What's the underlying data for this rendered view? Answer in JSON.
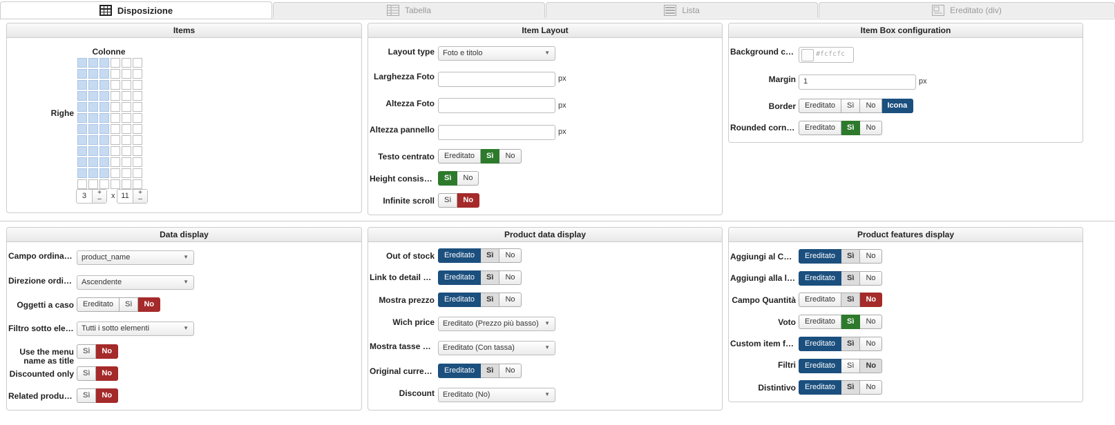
{
  "tabs": [
    "Disposizione",
    "Tabella",
    "Lista",
    "Ereditato (div)"
  ],
  "items_panel": {
    "title": "Items",
    "colonne_label": "Colonne",
    "righe_label": "Righe",
    "columns_value": "3",
    "rows_value": "11",
    "x_label": "x",
    "plus": "+",
    "minus": "–",
    "selected_columns": 3,
    "selected_rows": 11,
    "grid_columns": 6,
    "grid_rows": 12
  },
  "item_layout": {
    "title": "Item Layout",
    "layout_type_label": "Layout type",
    "layout_type_value": "Foto e titolo",
    "larghezza_label": "Larghezza Foto",
    "altezza_foto_label": "Altezza Foto",
    "altezza_pannello_label": "Altezza pannello",
    "unit_px": "px",
    "testo_centrato_label": "Testo centrato",
    "height_consistency_label": "Height consistency",
    "infinite_scroll_label": "Infinite scroll",
    "opt_ereditato": "Ereditato",
    "opt_si": "Sì",
    "opt_no": "No"
  },
  "item_box": {
    "title": "Item Box configuration",
    "background_color_label": "Background color",
    "background_color_placeholder": "#fcfcfc",
    "margin_label": "Margin",
    "margin_value": "1",
    "border_label": "Border",
    "rounded_label": "Rounded corners",
    "opt_icona": "Icona"
  },
  "data_display": {
    "title": "Data display",
    "campo_label": "Campo ordiname…",
    "campo_value": "product_name",
    "direzione_label": "Direzione ordina…",
    "direzione_value": "Ascendente",
    "oggetti_label": "Oggetti a caso",
    "filtro_label": "Filtro sotto eleme…",
    "filtro_value": "Tutti i sotto elementi",
    "use_menu_label_1": "Use the menu",
    "use_menu_label_2": "name as title",
    "discounted_label": "Discounted only",
    "related_label": "Related products…"
  },
  "product_data": {
    "title": "Product data display",
    "out_of_stock_label": "Out of stock",
    "link_detail_label": "Link to detail page",
    "mostra_prezzo_label": "Mostra prezzo",
    "wich_price_label": "Wich price",
    "wich_price_value": "Ereditato (Prezzo più basso)",
    "mostra_tasse_label": "Mostra tasse prezzi",
    "mostra_tasse_value": "Ereditato (Con tassa)",
    "original_currency_label": "Original currency",
    "discount_label": "Discount",
    "discount_value": "Ereditato (No)"
  },
  "product_features": {
    "title": "Product features display",
    "aggiungi_carrello_label": "Aggiungi al Carre…",
    "aggiungi_lista_label": "Aggiungi alla list…",
    "campo_quantita_label": "Campo Quantità",
    "voto_label": "Voto",
    "custom_fields_label": "Custom item fields",
    "filtri_label": "Filtri",
    "distintivo_label": "Distintivo"
  },
  "colors": {
    "active_green": "#2d7a2d",
    "active_red": "#a52a2a",
    "active_blue": "#1b4f7e",
    "grid_selected": "#c6dbf2"
  }
}
